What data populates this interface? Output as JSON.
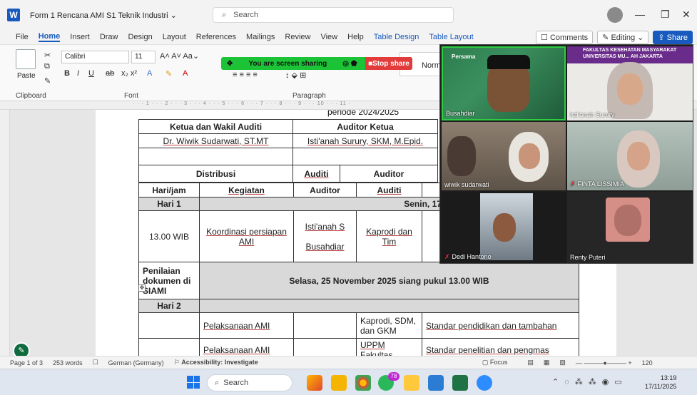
{
  "window": {
    "doc_title": "Form 1 Rencana AMI S1 Teknik Industri",
    "search_placeholder": "Search"
  },
  "menu": {
    "tabs": [
      "File",
      "Home",
      "Insert",
      "Draw",
      "Design",
      "Layout",
      "References",
      "Mailings",
      "Review",
      "View",
      "Help",
      "Table Design",
      "Table Layout"
    ],
    "comments": "Comments",
    "editing": "Editing",
    "share": "Share"
  },
  "ribbon": {
    "paste": "Paste",
    "font_name": "Calibri",
    "font_size": "11",
    "style_normal": "Normal",
    "group_clipboard": "Clipboard",
    "group_font": "Font",
    "group_paragraph": "Paragraph"
  },
  "share_banner": {
    "text": "You are screen sharing",
    "stop": "Stop share"
  },
  "document": {
    "periode": "periode 2024/2025",
    "table1": {
      "h_left": "Ketua dan Wakil Auditi",
      "h_right": "Auditor Ketua",
      "v_left": "Dr. Wiwik Sudarwati, ST.MT",
      "v_right": "Isti'anah Surury, SKM, M.Epid.",
      "distribusi": "Distribusi",
      "auditi": "Auditi",
      "auditor": "Auditor"
    },
    "table2": {
      "headers": [
        "Hari/jam",
        "Kegiatan",
        "Auditor",
        "Auditi"
      ],
      "hari1": "Hari 1",
      "hari1_date": "Senin, 17 November 2025",
      "row1_time": "13.00 WIB",
      "row1_kegiatan": "Koordinasi persiapan AMI",
      "row1_auditor_a": "Isti'anah S",
      "row1_auditor_b": "Busahdiar",
      "row1_auditi": "Kaprodi dan Tim",
      "penilaian": "Penilaian dokumen di SIAMI",
      "penilaian_date": "Selasa, 25 November 2025 siang pukul 13.00 WIB",
      "hari2": "Hari 2",
      "row2_kegiatan": "Pelaksanaan AMI",
      "row2_auditi": "Kaprodi, SDM, dan GKM",
      "row2_standar": "Standar pendidikan dan tambahan",
      "row3_kegiatan": "Pelaksanaan AMI",
      "row3_auditi": "UPPM Fakultas",
      "row3_standar": "Standar penelitian dan pengmas"
    }
  },
  "video": {
    "banner_fk": "FAKULTAS KESEHATAN MASYARAKAT",
    "banner_univ": "UNIVERSITAS MU... AH JAKARTA",
    "banner_small": "Persama",
    "participants": [
      "Busahdiar",
      "Isti'anah Surury",
      "wiwik sudarwati",
      "FINTA LISSIMIA",
      "Dedi Hantono",
      "Renty Puteri"
    ]
  },
  "status": {
    "page": "Page 1 of 3",
    "words": "253 words",
    "lang": "German (Germany)",
    "accessibility": "Accessibility: Investigate",
    "focus": "Focus",
    "zoom": "120"
  },
  "taskbar": {
    "search": "Search",
    "badge": "78",
    "time": "13:19",
    "date": "17/11/2025"
  }
}
